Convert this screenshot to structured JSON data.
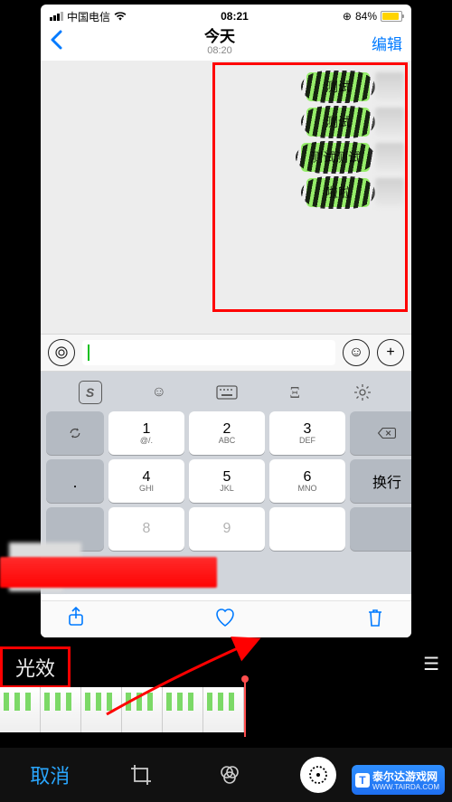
{
  "status": {
    "carrier": "中国电信",
    "time": "08:21",
    "battery_pct": "84%"
  },
  "nav": {
    "title": "今天",
    "subtitle": "08:20",
    "edit": "编辑"
  },
  "chat": {
    "messages": [
      "测试",
      "测试",
      "测试测试",
      "啦啦"
    ]
  },
  "keyboard": {
    "keys": {
      "k1": "1",
      "k2": "2",
      "k2s": "ABC",
      "k3": "3",
      "k3s": "DEF",
      "k4": "4",
      "k4s": "GHI",
      "k5": "5",
      "k5s": "JKL",
      "k6": "6",
      "k6s": "MNO",
      "return": "换行",
      "k8": "8",
      "k9": "9",
      "at": "@/."
    }
  },
  "editor": {
    "fx_label": "光效",
    "cancel": "取消"
  },
  "watermark": {
    "brand": "泰尔达游戏网",
    "url": "WWW.TAIRDA.COM",
    "t": "T"
  }
}
